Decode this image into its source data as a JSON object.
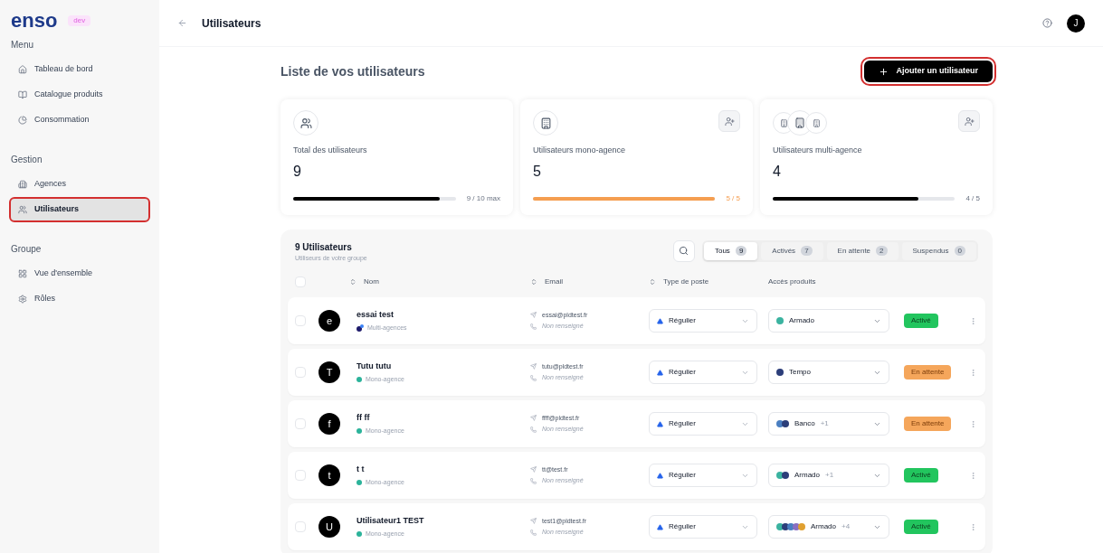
{
  "brand": {
    "logo": "enso",
    "badge": "dev"
  },
  "sidebar": {
    "sections": [
      {
        "title": "Menu",
        "items": [
          {
            "label": "Tableau de bord",
            "selected": false
          },
          {
            "label": "Catalogue produits",
            "selected": false
          },
          {
            "label": "Consommation",
            "selected": false
          }
        ]
      },
      {
        "title": "Gestion",
        "items": [
          {
            "label": "Agences",
            "selected": false
          },
          {
            "label": "Utilisateurs",
            "selected": true
          }
        ]
      },
      {
        "title": "Groupe",
        "items": [
          {
            "label": "Vue d'ensemble",
            "selected": false
          },
          {
            "label": "Rôles",
            "selected": false
          }
        ]
      }
    ]
  },
  "header": {
    "title": "Utilisateurs",
    "avatar": "J"
  },
  "page": {
    "title": "Liste de vos utilisateurs",
    "add_button": "Ajouter un utilisateur"
  },
  "stats": [
    {
      "kind": "total",
      "label": "Total des utilisateurs",
      "value": "9",
      "level": 0.9,
      "reading": "9 / 10 max",
      "full": false,
      "add": false
    },
    {
      "kind": "mono",
      "label": "Utilisateurs mono-agence",
      "value": "5",
      "level": 1,
      "reading": "5 / 5",
      "full": true,
      "add": true
    },
    {
      "kind": "multi",
      "label": "Utilisateurs multi-agence",
      "value": "4",
      "level": 0.8,
      "reading": "4 / 5",
      "full": false,
      "add": true
    }
  ],
  "table": {
    "title": "9 Utilisateurs",
    "subtitle": "Utiliseurs de votre groupe",
    "all_checked": false,
    "filters": [
      {
        "label": "Tous",
        "count": "9",
        "selected": true
      },
      {
        "label": "Activés",
        "count": "7",
        "selected": false
      },
      {
        "label": "En attente",
        "count": "2",
        "selected": false
      },
      {
        "label": "Suspendus",
        "count": "0",
        "selected": false
      }
    ],
    "columns": [
      {
        "label": "Nom",
        "sortable": true
      },
      {
        "label": "Email",
        "sortable": true
      },
      {
        "label": "Type de poste",
        "sortable": true
      },
      {
        "label": "Accès produits",
        "sortable": false
      }
    ],
    "rows": [
      {
        "initial": "e",
        "name": "essai test",
        "agency": {
          "label": "Multi-agences",
          "kind": "multi"
        },
        "email": "essai@pldtest.fr",
        "phone": "Non renseigné",
        "role": "Régulier",
        "products": [
          {
            "color": "#3bb3a0"
          }
        ],
        "product": "Armado",
        "extra": "",
        "status": {
          "label": "Activé",
          "kind": "active"
        },
        "checked": false
      },
      {
        "initial": "T",
        "name": "Tutu tutu",
        "agency": {
          "label": "Mono-agence",
          "kind": "mono"
        },
        "email": "tutu@pldtest.fr",
        "phone": "Non renseigné",
        "role": "Régulier",
        "products": [
          {
            "color": "#2c3e7a"
          }
        ],
        "product": "Tempo",
        "extra": "",
        "status": {
          "label": "En attente",
          "kind": "pending"
        },
        "checked": false
      },
      {
        "initial": "f",
        "name": "ff ff",
        "agency": {
          "label": "Mono-agence",
          "kind": "mono"
        },
        "email": "ffff@pldtest.fr",
        "phone": "Non renseigné",
        "role": "Régulier",
        "products": [
          {
            "color": "#4a7fc1"
          },
          {
            "color": "#2c3e7a"
          }
        ],
        "product": "Banco",
        "extra": "+1",
        "status": {
          "label": "En attente",
          "kind": "pending"
        },
        "checked": false
      },
      {
        "initial": "t",
        "name": "t t",
        "agency": {
          "label": "Mono-agence",
          "kind": "mono"
        },
        "email": "tt@test.fr",
        "phone": "Non renseigné",
        "role": "Régulier",
        "products": [
          {
            "color": "#3bb3a0"
          },
          {
            "color": "#2c3e7a"
          }
        ],
        "product": "Armado",
        "extra": "+1",
        "status": {
          "label": "Activé",
          "kind": "active"
        },
        "checked": false
      },
      {
        "initial": "U",
        "name": "Utilisateur1 TEST",
        "agency": {
          "label": "Mono-agence",
          "kind": "mono"
        },
        "email": "test1@pldtest.fr",
        "phone": "Non renseigné",
        "role": "Régulier",
        "products": [
          {
            "color": "#3bb3a0"
          },
          {
            "color": "#2c3e7a"
          },
          {
            "color": "#4a7fc1"
          },
          {
            "color": "#8a6fc1"
          },
          {
            "color": "#e0a030"
          }
        ],
        "product": "Armado",
        "extra": "+4",
        "status": {
          "label": "Activé",
          "kind": "active"
        },
        "checked": false
      }
    ]
  }
}
